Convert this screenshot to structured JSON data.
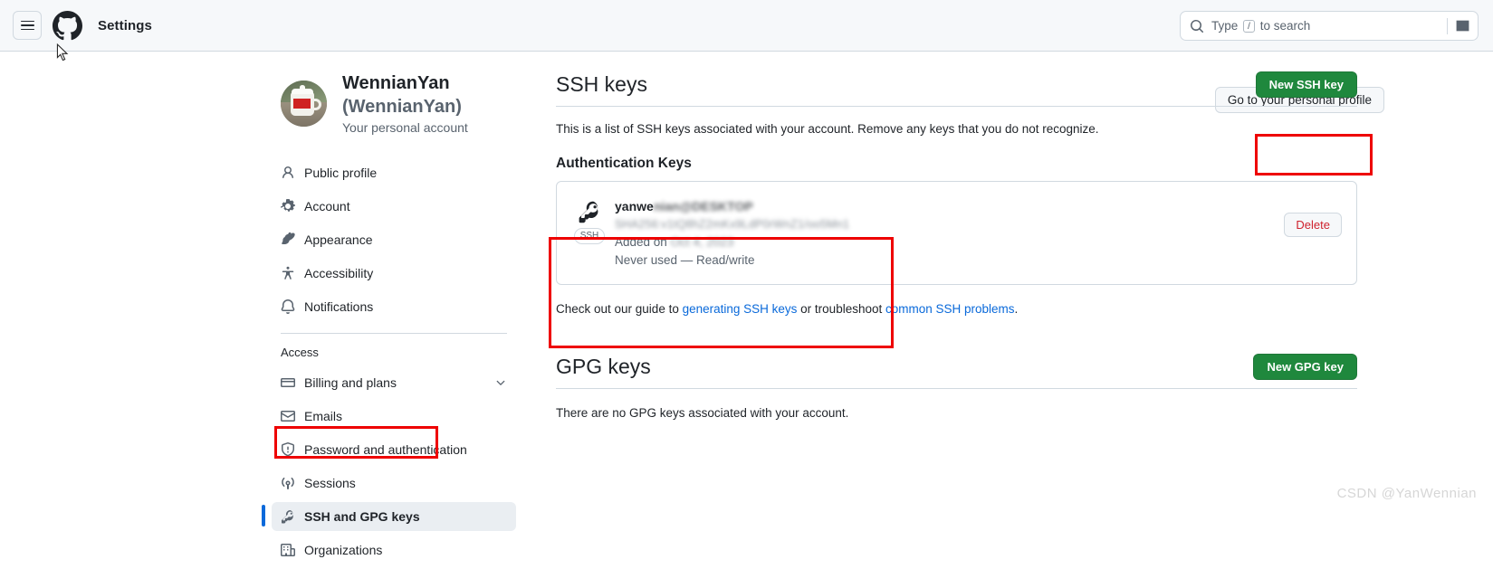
{
  "header": {
    "menu_icon": "hamburger-icon",
    "logo_icon": "github-mark-icon",
    "title": "Settings",
    "search": {
      "icon": "search-icon",
      "placeholder_before": "Type",
      "placeholder_key": "/",
      "placeholder_after": "to search",
      "command_icon": "terminal-icon"
    }
  },
  "account": {
    "avatar_alt": "user-avatar-mug-photo",
    "name": "WennianYan",
    "handle": "(WennianYan)",
    "subtitle": "Your personal account",
    "profile_button": "Go to your personal profile"
  },
  "sidebar": {
    "items": [
      {
        "label": "Public profile",
        "icon": "person-icon",
        "selected": false
      },
      {
        "label": "Account",
        "icon": "gear-icon",
        "selected": false
      },
      {
        "label": "Appearance",
        "icon": "paintbrush-icon",
        "selected": false
      },
      {
        "label": "Accessibility",
        "icon": "accessibility-icon",
        "selected": false
      },
      {
        "label": "Notifications",
        "icon": "bell-icon",
        "selected": false
      }
    ],
    "section_label": "Access",
    "access_items": [
      {
        "label": "Billing and plans",
        "icon": "credit-card-icon",
        "selected": false,
        "chevron": "chevron-down-icon"
      },
      {
        "label": "Emails",
        "icon": "mail-icon",
        "selected": false
      },
      {
        "label": "Password and authentication",
        "icon": "shield-icon",
        "selected": false
      },
      {
        "label": "Sessions",
        "icon": "broadcast-icon",
        "selected": false
      },
      {
        "label": "SSH and GPG keys",
        "icon": "key-icon",
        "selected": true
      },
      {
        "label": "Organizations",
        "icon": "organization-icon",
        "selected": false
      }
    ]
  },
  "ssh_section": {
    "title": "SSH keys",
    "new_button": "New SSH key",
    "description": "This is a list of SSH keys associated with your account. Remove any keys that you do not recognize.",
    "subheading": "Authentication Keys",
    "key": {
      "icon": "key-icon",
      "badge": "SSH",
      "name_visible": "yanwe",
      "name_blurred": "nian@DESKTOP",
      "fingerprint_blurred": "SHA256:v1tQ8hZ2mKx9LdP0rWnZ1/oo5Mn1",
      "added_prefix": "Added on",
      "added_blurred": "Oct 4, 2023",
      "usage": "Never used — Read/write",
      "delete_button": "Delete"
    },
    "guide_prefix": "Check out our guide to ",
    "guide_link1": "generating SSH keys",
    "guide_middle": " or troubleshoot ",
    "guide_link2": "common SSH problems",
    "guide_suffix": "."
  },
  "gpg_section": {
    "title": "GPG keys",
    "new_button": "New GPG key",
    "empty_text": "There are no GPG keys associated with your account."
  },
  "annotations": {
    "color": "#ee0000",
    "boxes": [
      "new-ssh-key-button",
      "ssh-key-entry",
      "sidebar-ssh-and-gpg-keys"
    ]
  },
  "watermark": "CSDN @YanWennian"
}
